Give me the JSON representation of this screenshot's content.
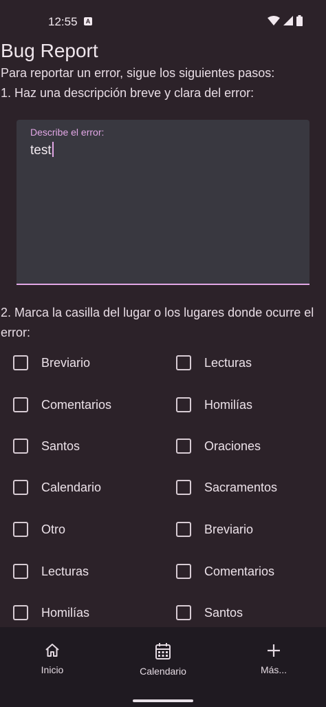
{
  "status_bar": {
    "time": "12:55",
    "notification_glyph": "A"
  },
  "page": {
    "title": "Bug Report",
    "intro": "Para reportar un error, sigue los siguientes pasos:",
    "step1": "1. Haz una descripción breve y clara del error:",
    "step2": "2. Marca la casilla del lugar o los lugares donde ocurre el error:"
  },
  "description_field": {
    "label": "Describe el error:",
    "value": "test"
  },
  "checkboxes": [
    {
      "label": "Breviario",
      "checked": false
    },
    {
      "label": "Lecturas",
      "checked": false
    },
    {
      "label": "Comentarios",
      "checked": false
    },
    {
      "label": "Homilías",
      "checked": false
    },
    {
      "label": "Santos",
      "checked": false
    },
    {
      "label": "Oraciones",
      "checked": false
    },
    {
      "label": "Calendario",
      "checked": false
    },
    {
      "label": "Sacramentos",
      "checked": false
    },
    {
      "label": "Otro",
      "checked": false
    },
    {
      "label": "Breviario",
      "checked": false
    },
    {
      "label": "Lecturas",
      "checked": false
    },
    {
      "label": "Comentarios",
      "checked": false
    },
    {
      "label": "Homilías",
      "checked": false
    },
    {
      "label": "Santos",
      "checked": false
    }
  ],
  "bottom_nav": {
    "items": [
      {
        "label": "Inicio",
        "icon": "home-icon"
      },
      {
        "label": "Calendario",
        "icon": "calendar-icon"
      },
      {
        "label": "Más...",
        "icon": "plus-icon"
      }
    ]
  },
  "colors": {
    "background": "#2c2229",
    "accent": "#e2a7e6",
    "field": "#393840",
    "nav": "#1f1a21"
  }
}
